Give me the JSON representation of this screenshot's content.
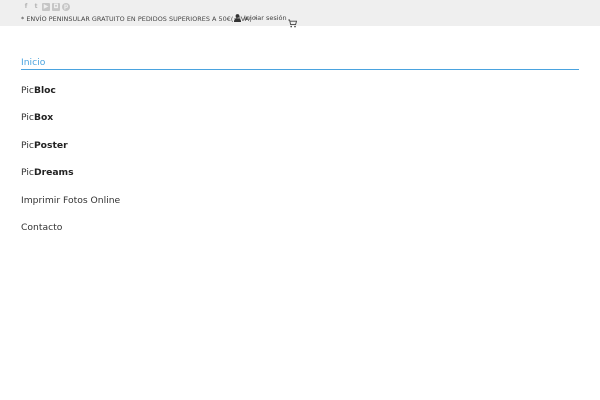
{
  "topbar": {
    "social": [
      {
        "icon": "facebook-icon",
        "glyph": "f"
      },
      {
        "icon": "twitter-icon",
        "glyph": "t"
      },
      {
        "icon": "youtube-icon",
        "glyph": "▶"
      },
      {
        "icon": "instagram-icon",
        "glyph": "◘"
      },
      {
        "icon": "pinterest-icon",
        "glyph": "p"
      }
    ],
    "promo_text": "* ENVÍO PENINSULAR GRATUITO EN PEDIDOS SUPERIORES A 50€(+IVA) *",
    "login_label": "Iniciar sesión"
  },
  "menu": {
    "inicio": "Inicio",
    "picbloc_prefix": "Pic",
    "picbloc_bold": "Bloc",
    "picbox_prefix": "Pic",
    "picbox_bold": "Box",
    "picposter_prefix": "Pic",
    "picposter_bold": "Poster",
    "picdreams_prefix": "Pic",
    "picdreams_bold": "Dreams",
    "imprimir": "Imprimir Fotos Online",
    "contacto": "Contacto"
  },
  "colors": {
    "accent": "#4aa3df",
    "topbar_bg": "#efefef"
  }
}
